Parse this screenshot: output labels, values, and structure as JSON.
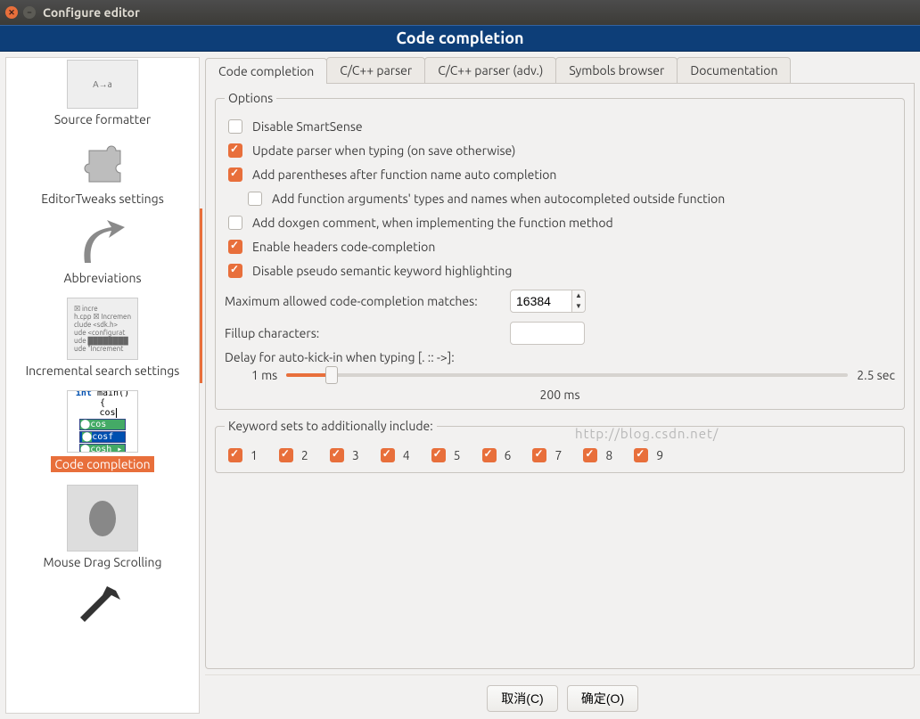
{
  "window": {
    "title": "Configure editor"
  },
  "banner": "Code completion",
  "sidebar": {
    "items": [
      {
        "label": "Source formatter",
        "selected": false
      },
      {
        "label": "EditorTweaks settings",
        "selected": false
      },
      {
        "label": "Abbreviations",
        "selected": false
      },
      {
        "label": "Incremental search settings",
        "selected": false
      },
      {
        "label": "Code completion",
        "selected": true
      },
      {
        "label": "Mouse Drag Scrolling",
        "selected": false
      }
    ]
  },
  "tabs": [
    {
      "label": "Code completion",
      "active": true
    },
    {
      "label": "C/C++ parser",
      "active": false
    },
    {
      "label": "C/C++ parser (adv.)",
      "active": false
    },
    {
      "label": "Symbols browser",
      "active": false
    },
    {
      "label": "Documentation",
      "active": false
    }
  ],
  "options": {
    "legend": "Options",
    "disable_smartsense": {
      "label": "Disable SmartSense",
      "checked": false
    },
    "update_parser": {
      "label": "Update parser when typing (on save otherwise)",
      "checked": true
    },
    "add_parens": {
      "label": "Add parentheses after function name auto completion",
      "checked": true
    },
    "add_args": {
      "label": "Add function arguments' types and names when autocompleted outside function",
      "checked": false
    },
    "add_doxygen": {
      "label": "Add doxgen comment, when implementing the function method",
      "checked": false
    },
    "enable_headers": {
      "label": "Enable headers code-completion",
      "checked": true
    },
    "disable_pseudo": {
      "label": "Disable pseudo semantic keyword highlighting",
      "checked": true
    },
    "max_matches": {
      "label": "Maximum allowed code-completion matches:",
      "value": "16384"
    },
    "fillup": {
      "label": "Fillup characters:",
      "value": ""
    },
    "delay": {
      "label": "Delay for auto-kick-in when typing [. :: ->]:",
      "min_label": "1 ms",
      "max_label": "2.5 sec",
      "current_label": "200 ms",
      "fraction": 0.08
    }
  },
  "keywords": {
    "legend": "Keyword sets to additionally include:",
    "sets": [
      {
        "label": "1",
        "checked": true
      },
      {
        "label": "2",
        "checked": true
      },
      {
        "label": "3",
        "checked": true
      },
      {
        "label": "4",
        "checked": true
      },
      {
        "label": "5",
        "checked": true
      },
      {
        "label": "6",
        "checked": true
      },
      {
        "label": "7",
        "checked": true
      },
      {
        "label": "8",
        "checked": true
      },
      {
        "label": "9",
        "checked": true
      }
    ]
  },
  "buttons": {
    "cancel": "取消(C)",
    "ok": "确定(O)"
  },
  "watermark": "http://blog.csdn.net/"
}
